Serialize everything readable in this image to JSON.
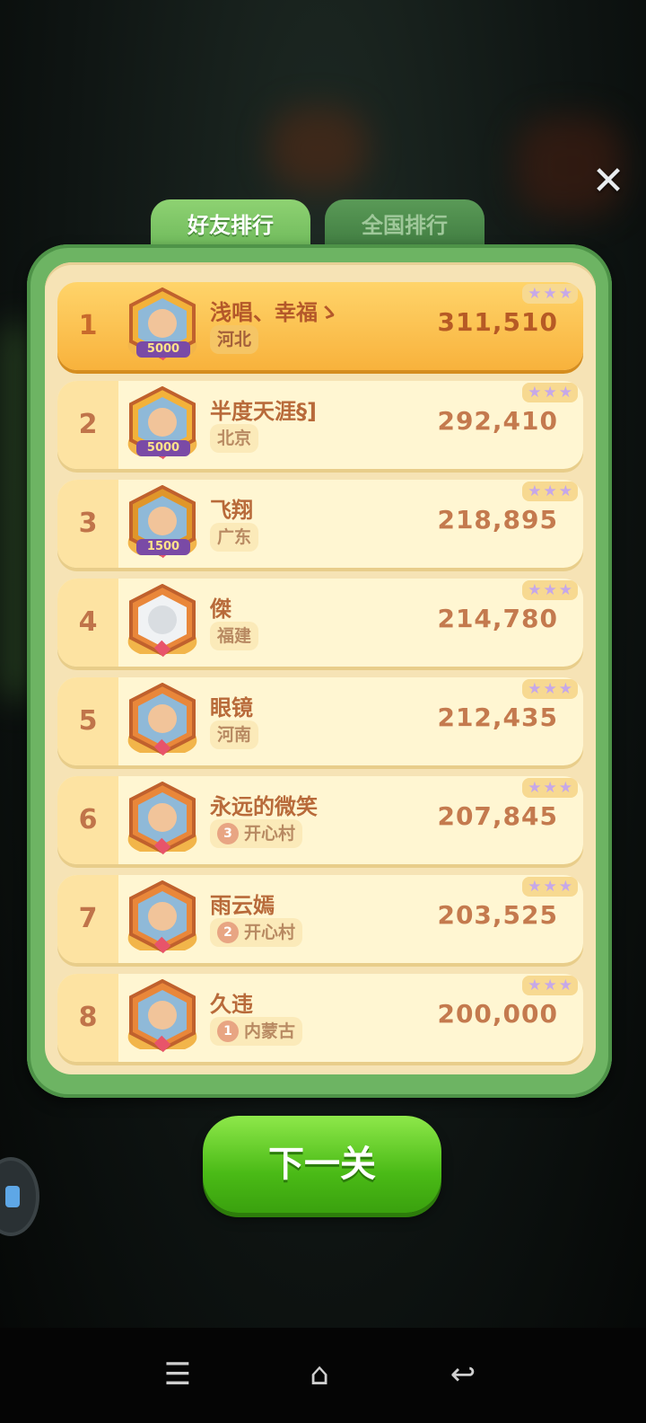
{
  "tabs": {
    "friends": "好友排行",
    "national": "全国排行"
  },
  "close_icon": "close-icon",
  "rows": [
    {
      "rank": "1",
      "name": "浅唱、幸福ゝ",
      "location": "河北",
      "level": "",
      "score": "311,510",
      "avatar_badge": "5000",
      "avatar_icon": "earth-frame-avatar-icon"
    },
    {
      "rank": "2",
      "name": "半度天涯§]",
      "location": "北京",
      "level": "",
      "score": "292,410",
      "avatar_badge": "5000",
      "avatar_icon": "pig-frame-avatar-icon"
    },
    {
      "rank": "3",
      "name": "飞翔",
      "location": "广东",
      "level": "",
      "score": "218,895",
      "avatar_badge": "1500",
      "avatar_icon": "anime-girl-avatar-icon"
    },
    {
      "rank": "4",
      "name": "傑",
      "location": "福建",
      "level": "",
      "score": "214,780",
      "avatar_badge": "",
      "avatar_icon": "mountain-avatar-icon"
    },
    {
      "rank": "5",
      "name": "眼镜",
      "location": "河南",
      "level": "",
      "score": "212,435",
      "avatar_badge": "",
      "avatar_icon": "glasses-avatar-icon"
    },
    {
      "rank": "6",
      "name": "永远的微笑",
      "location": "开心村",
      "level": "3",
      "score": "207,845",
      "avatar_badge": "",
      "avatar_icon": "cartoon-boy-avatar-icon"
    },
    {
      "rank": "7",
      "name": "雨云嫣",
      "location": "开心村",
      "level": "2",
      "score": "203,525",
      "avatar_badge": "",
      "avatar_icon": "photo-avatar-icon"
    },
    {
      "rank": "8",
      "name": "久违",
      "location": "内蒙古",
      "level": "1",
      "score": "200,000",
      "avatar_badge": "",
      "avatar_icon": "photo-woman-avatar-icon"
    }
  ],
  "next_button": "下一关",
  "colors": {
    "panel": "#6db463",
    "row": "#fff6d2",
    "top_row": "#f8b23c",
    "button": "#4aba16"
  }
}
